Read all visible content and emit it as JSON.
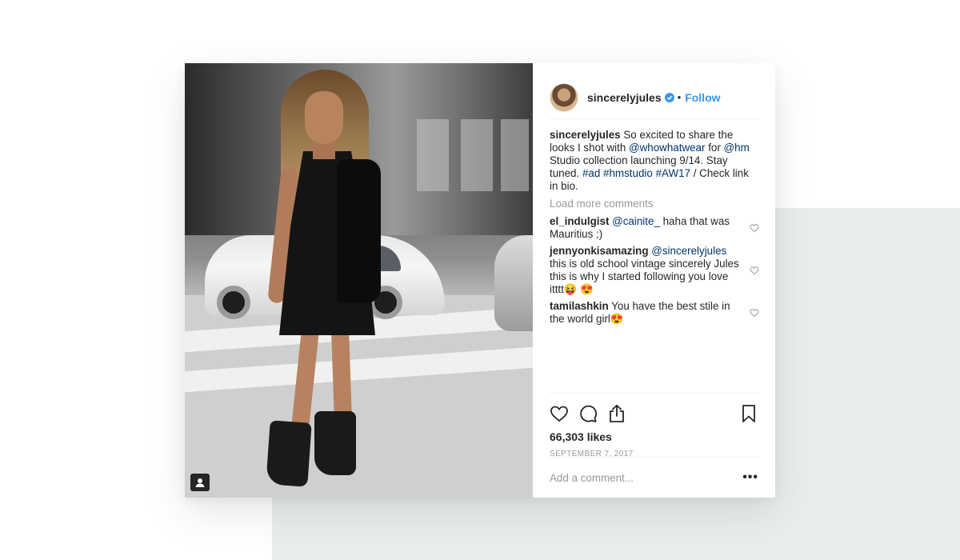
{
  "post": {
    "username": "sincerelyjules",
    "separator": "•",
    "follow_label": "Follow",
    "caption": {
      "username": "sincerelyjules",
      "t1": " So excited to share the looks I shot with ",
      "m1": "@whowhatwear",
      "t2": " for ",
      "m2": "@hm",
      "t3": " Studio collection launching 9/14. Stay tuned. ",
      "h1": "#ad",
      "t4": " ",
      "h2": "#hmstudio",
      "t5": " ",
      "h3": "#AW17",
      "t6": " / Check link in bio."
    },
    "load_more": "Load more comments",
    "comments": [
      {
        "username": "el_indulgist",
        "mention": "@cainite_",
        "text": " haha that was Mauritius ;)"
      },
      {
        "username": "jennyonkisamazing",
        "mention": "@sincerelyjules",
        "text": " this is old school vintage sincerely Jules this is why I started following you love itttt😝 😍"
      },
      {
        "username": "tamilashkin",
        "mention": "",
        "text": " You have the best stile in the world girl😍"
      }
    ],
    "likes": "66,303 likes",
    "date": "SEPTEMBER 7, 2017",
    "add_comment_placeholder": "Add a comment...",
    "more_label": "•••"
  },
  "icons": {
    "verified": "verified-badge-icon",
    "like": "heart-icon",
    "comment": "comment-icon",
    "share": "share-icon",
    "save": "bookmark-icon",
    "comment_like": "heart-outline-icon",
    "tag": "user-tag-icon"
  },
  "colors": {
    "link": "#003569",
    "follow": "#3897f0",
    "muted": "#999999",
    "verified": "#3897f0"
  }
}
